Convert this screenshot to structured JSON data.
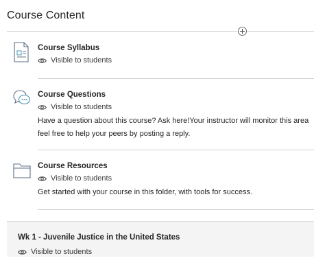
{
  "section": {
    "title": "Course Content"
  },
  "items": [
    {
      "icon": "document-icon",
      "title": "Course Syllabus",
      "visibility": "Visible to students",
      "description": []
    },
    {
      "icon": "discussion-icon",
      "title": "Course Questions",
      "visibility": "Visible to students",
      "description": [
        "Have a question about this course? Ask here!Your instructor will monitor this area",
        "feel free to help your peers by posting a reply."
      ]
    },
    {
      "icon": "folder-icon",
      "title": "Course Resources",
      "visibility": "Visible to students",
      "description": [
        "Get started with your course in this folder, with tools for success."
      ]
    }
  ],
  "learning_module": {
    "title": "Wk 1 - Juvenile Justice in the United States",
    "visibility": "Visible to students"
  },
  "colors": {
    "divider": "#cfcfcf",
    "icon_stroke": "#5b6f87",
    "discussion_accent": "#4a90b8",
    "module_background": "#f4f4f4"
  }
}
